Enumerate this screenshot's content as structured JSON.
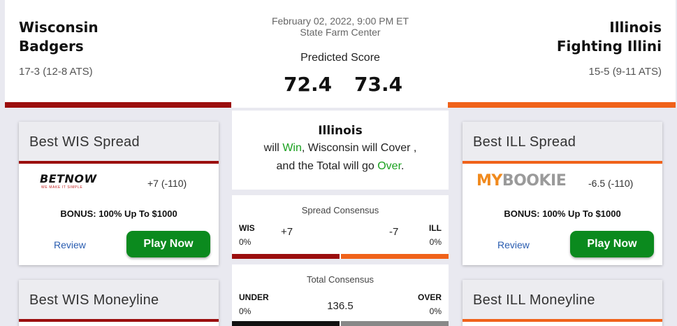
{
  "game": {
    "date_time": "February 02, 2022, 9:00 PM ET",
    "venue": "State Farm Center",
    "predicted_label": "Predicted Score",
    "score_away": "72.4",
    "score_home": "73.4"
  },
  "away": {
    "name_line1": "Wisconsin",
    "name_line2": "Badgers",
    "record": "17-3 (12-8 ATS)",
    "abbr": "WIS",
    "color": "#9b0e0e"
  },
  "home": {
    "name_line1": "Illinois",
    "name_line2": "Fighting Illini",
    "record": "15-5 (9-11 ATS)",
    "abbr": "ILL",
    "color": "#f0621a"
  },
  "pick": {
    "team": "Illinois",
    "line1_prefix": "will ",
    "line1_result": "Win",
    "line1_suffix": ", Wisconsin will Cover ,",
    "line2_prefix": "and the Total will go ",
    "line2_result": "Over",
    "line2_suffix": "."
  },
  "spread_consensus": {
    "title": "Spread Consensus",
    "left_label": "WIS",
    "left_pct": "0%",
    "left_value": "+7",
    "right_value": "-7",
    "right_label": "ILL",
    "right_pct": "0%"
  },
  "total_consensus": {
    "title": "Total Consensus",
    "left_label": "UNDER",
    "left_pct": "0%",
    "value": "136.5",
    "right_label": "OVER",
    "right_pct": "0%"
  },
  "wis_spread_card": {
    "title": "Best WIS Spread",
    "book_logo_text": "BETNOW",
    "book_tagline": "WE MAKE IT SIMPLE",
    "odds": "+7 (-110)",
    "bonus": "BONUS: 100% Up To $1000",
    "review": "Review",
    "play": "Play Now"
  },
  "ill_spread_card": {
    "title": "Best ILL Spread",
    "book_logo_my": "MY",
    "book_logo_rest": "BOOKIE",
    "odds": "-6.5 (-110)",
    "bonus": "BONUS: 100% Up To $1000",
    "review": "Review",
    "play": "Play Now"
  },
  "wis_moneyline_card": {
    "title": "Best WIS Moneyline"
  },
  "ill_moneyline_card": {
    "title": "Best ILL Moneyline"
  },
  "colors": {
    "cta_green": "#0b8a1e",
    "result_green": "#19a01e",
    "link_blue": "#2a5db0"
  }
}
